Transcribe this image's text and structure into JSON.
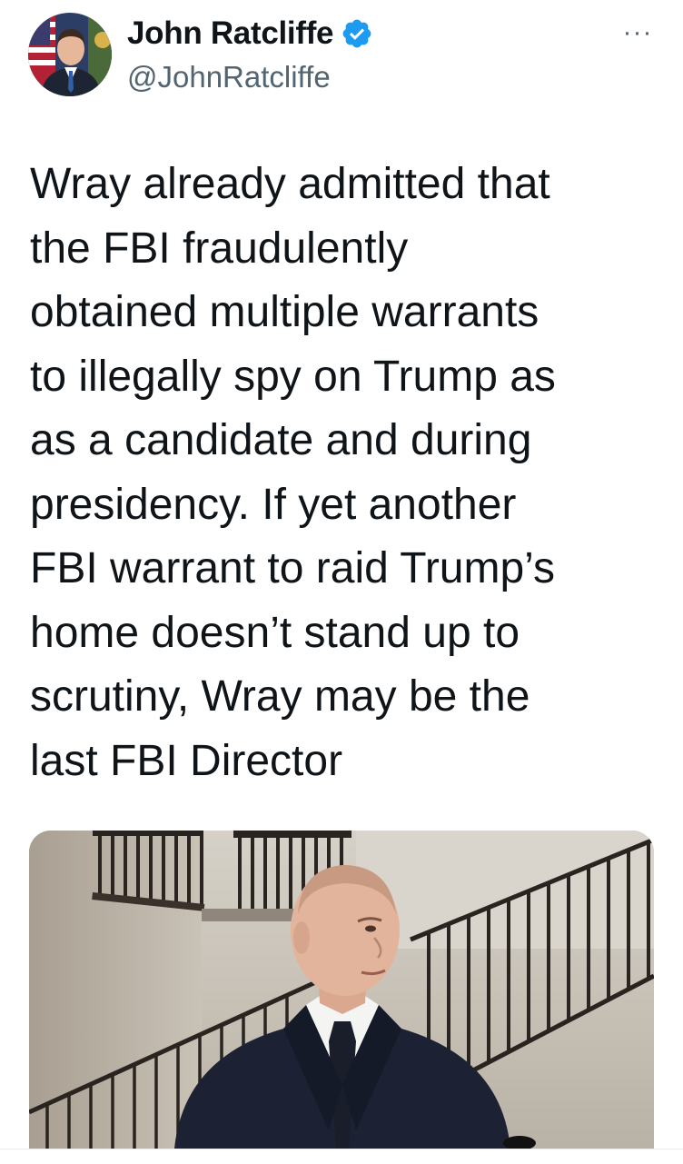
{
  "tweet": {
    "author": {
      "display_name": "John Ratcliffe",
      "handle": "@JohnRatcliffe",
      "verified": true,
      "avatar_icon": "profile-photo"
    },
    "more_icon": "more-horizontal-icon",
    "more_label": "···",
    "text_lines": [
      "Wray already admitted that",
      "the FBI fraudulently",
      "obtained multiple warrants",
      "to illegally spy on Trump as",
      "as a candidate and during",
      "presidency. If yet another",
      "FBI warrant to raid Trump’s",
      "home doesn’t stand up to",
      "scrutiny, Wray may be the",
      "last FBI Director"
    ],
    "media": {
      "type": "photo"
    }
  },
  "colors": {
    "text_primary": "#0f1419",
    "text_secondary": "#536471",
    "verified_blue": "#1d9bf0",
    "background": "#ffffff"
  }
}
